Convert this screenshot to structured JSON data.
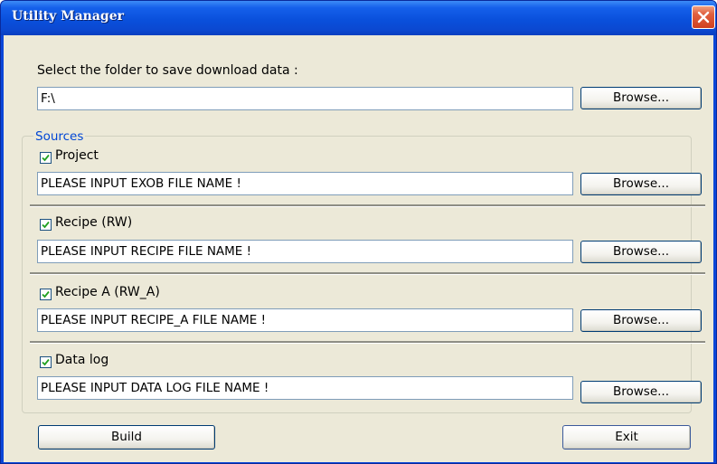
{
  "window": {
    "title": "Utility Manager"
  },
  "folder": {
    "label": "Select the folder to save download data :",
    "value": "F:\\",
    "browse_label": "Browse..."
  },
  "sources": {
    "group_label": "Sources",
    "items": [
      {
        "label": "Project",
        "checked": true,
        "value": "PLEASE INPUT EXOB FILE NAME !",
        "browse_label": "Browse..."
      },
      {
        "label": "Recipe (RW)",
        "checked": true,
        "value": "PLEASE INPUT RECIPE FILE NAME !",
        "browse_label": "Browse..."
      },
      {
        "label": "Recipe A (RW_A)",
        "checked": true,
        "value": "PLEASE INPUT RECIPE_A FILE NAME !",
        "browse_label": "Browse..."
      },
      {
        "label": "Data log",
        "checked": true,
        "value": "PLEASE INPUT DATA LOG FILE NAME !",
        "browse_label": "Browse..."
      }
    ]
  },
  "actions": {
    "build_label": "Build",
    "exit_label": "Exit"
  },
  "colors": {
    "title_bar": "#0a50dc",
    "client_bg": "#ece9d8",
    "group_label": "#0046d5",
    "close_button": "#d04020"
  }
}
